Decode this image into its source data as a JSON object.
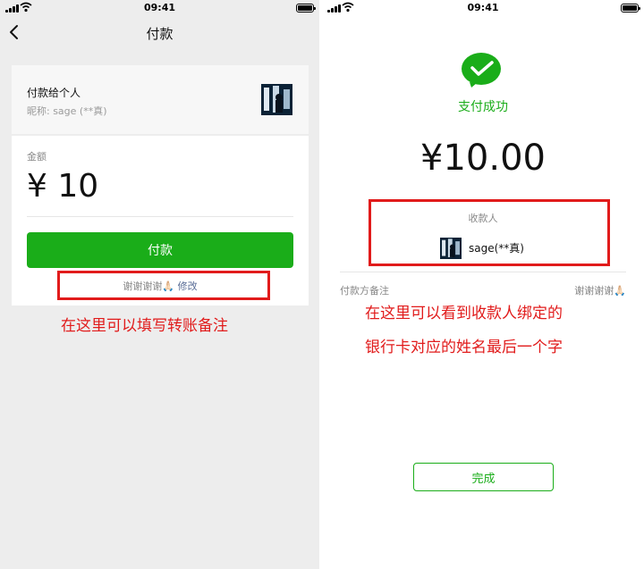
{
  "left": {
    "status_time": "09:41",
    "nav_title": "付款",
    "payee_label": "付款给个人",
    "payee_nickname": "昵称: sage (**真)",
    "amount_label": "金额",
    "amount_value": "¥ 10",
    "pay_button": "付款",
    "remark_text": "谢谢谢谢🙏🏻",
    "remark_edit": "修改",
    "annotation": "在这里可以填写转账备注"
  },
  "right": {
    "status_time": "09:41",
    "success_text": "支付成功",
    "amount": "¥10.00",
    "payee_header": "收款人",
    "payee_name": "sage(**真)",
    "note_label": "付款方备注",
    "note_value": "谢谢谢谢🙏🏻",
    "annotation_line1": "在这里可以看到收款人绑定的",
    "annotation_line2": "银行卡对应的姓名最后一个字",
    "done_button": "完成"
  },
  "colors": {
    "wechat_green": "#1aad19",
    "annotation_red": "#e11b1b",
    "link_blue": "#576b95",
    "page_gray": "#ededed"
  },
  "icons": [
    "signal-icon",
    "wifi-icon",
    "battery-icon",
    "back-arrow-icon",
    "success-check-icon",
    "avatar"
  ]
}
